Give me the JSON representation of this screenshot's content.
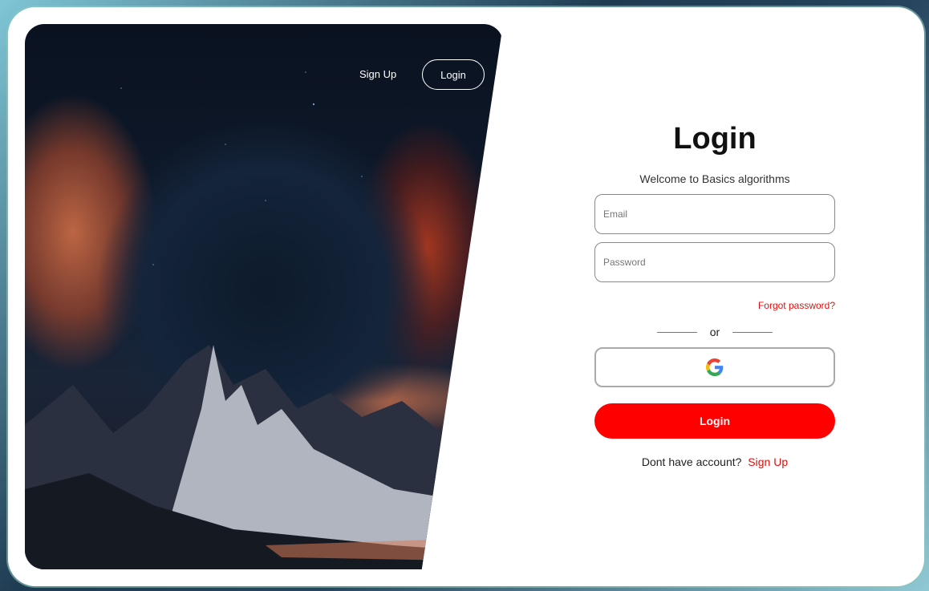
{
  "hero": {
    "nav": {
      "signup_label": "Sign Up",
      "login_label": "Login"
    }
  },
  "form": {
    "title": "Login",
    "subtitle": "Welcome to Basics algorithms",
    "email_placeholder": "Email",
    "password_placeholder": "Password",
    "forgot_label": "Forgot password?",
    "divider_label": "or",
    "google_icon": "google-icon",
    "login_label": "Login",
    "no_account_text": "Dont have account?",
    "signup_label": "Sign Up"
  },
  "colors": {
    "accent": "#ff0000",
    "link": "#e01010",
    "title": "#111111"
  }
}
